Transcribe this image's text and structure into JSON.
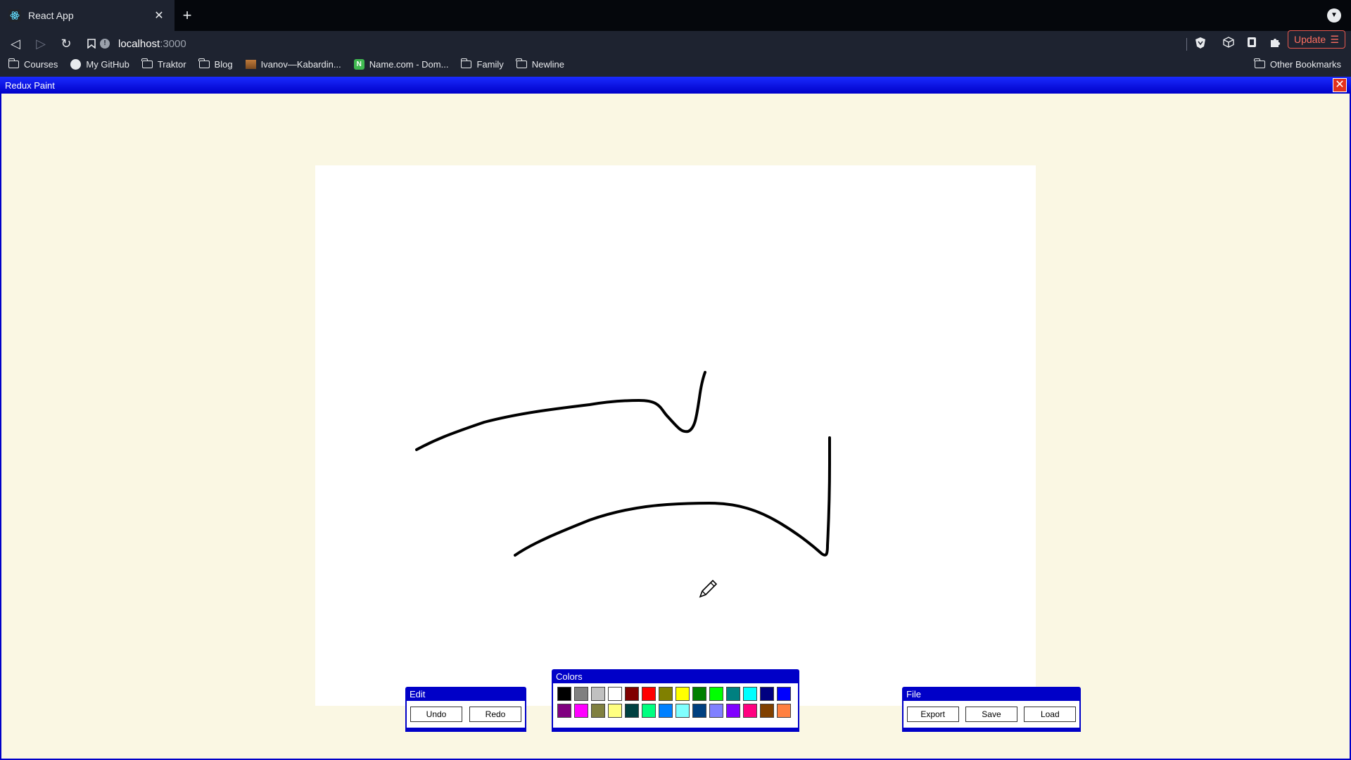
{
  "browser": {
    "tab_title": "React App",
    "url_host": "localhost",
    "url_port": ":3000",
    "update_label": "Update",
    "bookmarks": [
      "Courses",
      "My GitHub",
      "Traktor",
      "Blog",
      "Ivanov—Kabardin...",
      "Name.com - Dom...",
      "Family",
      "Newline"
    ],
    "other_bookmarks": "Other Bookmarks"
  },
  "app": {
    "title": "Redux Paint",
    "edit_panel": {
      "title": "Edit",
      "undo": "Undo",
      "redo": "Redo"
    },
    "colors_panel": {
      "title": "Colors",
      "swatches_row1": [
        "#000000",
        "#808080",
        "#c0c0c0",
        "#ffffff",
        "#800000",
        "#ff0000",
        "#808000",
        "#ffff00",
        "#008000",
        "#00ff00",
        "#008080",
        "#00ffff",
        "#000080",
        "#0000ff"
      ],
      "swatches_row2": [
        "#800080",
        "#ff00ff",
        "#808040",
        "#ffff80",
        "#004040",
        "#00ff80",
        "#0080ff",
        "#80ffff",
        "#004080",
        "#8080ff",
        "#8000ff",
        "#ff0080",
        "#804000",
        "#ff8040"
      ]
    },
    "file_panel": {
      "title": "File",
      "export": "Export",
      "save": "Save",
      "load": "Load"
    }
  },
  "accent_colors": {
    "window_blue": "#0000c8",
    "canvas_bg": "#faf7e3",
    "close_red": "#e2311d"
  }
}
